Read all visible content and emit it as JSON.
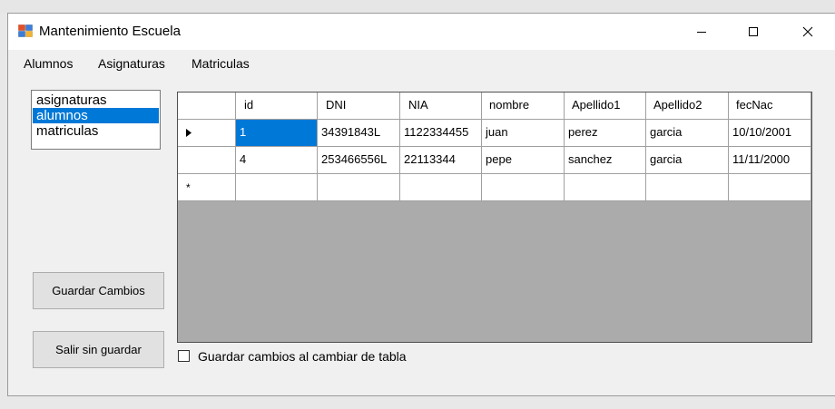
{
  "window": {
    "title": "Mantenimiento Escuela",
    "controls": [
      "minimize",
      "maximize",
      "close"
    ]
  },
  "menu": [
    "Alumnos",
    "Asignaturas",
    "Matriculas"
  ],
  "tables_list": {
    "items": [
      "asignaturas",
      "alumnos",
      "matriculas"
    ],
    "selected_index": 1
  },
  "buttons": {
    "save": "Guardar Cambios",
    "exit": "Salir sin guardar"
  },
  "grid": {
    "columns": [
      "id",
      "DNI",
      "NIA",
      "nombre",
      "Apellido1",
      "Apellido2",
      "fecNac"
    ],
    "rows": [
      [
        "1",
        "34391843L",
        "1122334455",
        "juan",
        "perez",
        "garcia",
        "10/10/2001"
      ],
      [
        "4",
        "253466556L",
        "22113344",
        "pepe",
        "sanchez",
        "garcia",
        "11/11/2000"
      ]
    ],
    "current_row_marker": "▸",
    "new_row_marker": "*"
  },
  "checkbox": {
    "label": "Guardar cambios  al cambiar de tabla",
    "checked": false
  },
  "colors": {
    "selection": "#0078d7",
    "grid_background": "#ababab"
  }
}
